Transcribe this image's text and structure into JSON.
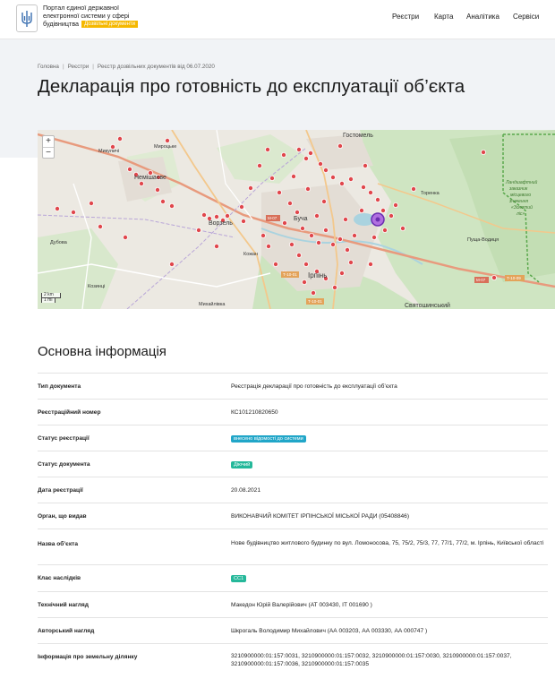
{
  "header": {
    "logo_line1": "Портал єдиної державної",
    "logo_line2": "електронної системи у сфері",
    "logo_line3": "будівництва",
    "logo_badge": "Дозвільні документи",
    "nav": [
      "Реєстри",
      "Карта",
      "Аналітика",
      "Сервіси"
    ]
  },
  "breadcrumbs": [
    "Головна",
    "Реєстри",
    "Реєстр дозвільних документів від 06.07.2020"
  ],
  "page_title": "Декларація про готовність до експлуатації об’єкта",
  "map": {
    "zoom_in": "+",
    "zoom_out": "−",
    "scale_km": "2 km",
    "scale_mi": "1 mi",
    "labels": {
      "hostomel": "Гостомель",
      "nemishaieve": "Немішаєве",
      "vorzel": "Ворзель",
      "bucha": "Буча",
      "irpin": "Ірпінь",
      "torenka": "Торенка",
      "pushcha": "Пуща-Водиця",
      "myrotske": "Мироцьке",
      "mykulychi": "Микуличі",
      "dubova": "Дубова",
      "kozyntsi": "Козинці",
      "mykhailivka": "Михайлівка",
      "kozhan": "Кожан",
      "sviatoshynskyi": "Святошинський",
      "zakaznyk1": "Ландшафтний",
      "zakaznyk2": "заказник",
      "zakaznyk3": "місцевого",
      "zakaznyk4": "значення",
      "zakaznyk5": "«Золотий",
      "zakaznyk6": "ліс»",
      "road_m07a": "М-07",
      "road_m07b": "М-07",
      "road_t1001": "Т-10-01",
      "road_t1009": "Т-10-09",
      "road_h1701": "Т-10-01"
    }
  },
  "main_info": {
    "title": "Основна інформація",
    "rows": [
      {
        "label": "Тип документа",
        "value": "Реєстрація декларації про готовність до експлуатації об’єкта"
      },
      {
        "label": "Реєстраційний номер",
        "value": "КС101210820650"
      },
      {
        "label": "Статус реєстрації",
        "badge": "внесено відомості до системи"
      },
      {
        "label": "Статус документа",
        "badge": "Діючий"
      },
      {
        "label": "Дата реєстрації",
        "value": "20.08.2021"
      },
      {
        "label": "Орган, що видав",
        "value": "ВИКОНАВЧИЙ КОМІТЕТ ІРПІНСЬКОЇ МІСЬКОЇ РАДИ (05408846)"
      },
      {
        "label": "Назва об’єкта",
        "value": "Нове будівництво житлового будинку по вул. Ломоносова, 75, 75/2, 75/3, 77, 77/1, 77/2, м. Ірпінь, Київської області"
      },
      {
        "label": "Клас наслідків",
        "badge": "СС1"
      },
      {
        "label": "Технічний нагляд",
        "value": "Македон Юрій Валерійович (АТ 003430, ІТ 001690 )"
      },
      {
        "label": "Авторський нагляд",
        "value": "Шкрогаль Володимир Михайлович (АА 003203, АА 003330, АА 000747 )"
      },
      {
        "label": "Інформація про земельну ділянку",
        "value": "3210900000:01:157:0031, 3210900000:01:157:0032, 3210900000:01:157:0030, 3210900000:01:157:0037, 3210900000:01:157:0036, 3210900000:01:157:0035"
      }
    ]
  },
  "colors": {
    "accent_yellow": "#f5b800",
    "badge_blue": "#21a6c8",
    "badge_green": "#25b89a",
    "marker_red": "#e0474c",
    "selected_marker": "#8a3fd1"
  }
}
